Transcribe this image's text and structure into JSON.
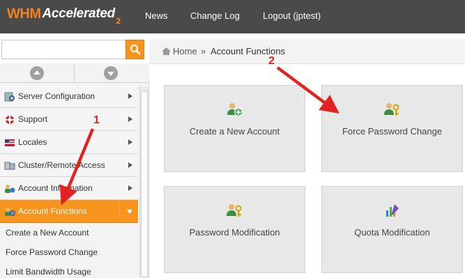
{
  "topbar": {
    "logo_brand": "WHM",
    "logo_name": "Accelerated",
    "logo_version": "2",
    "nav": [
      "News",
      "Change Log",
      "Logout (jptest)"
    ]
  },
  "search": {
    "placeholder": "",
    "value": ""
  },
  "breadcrumb": {
    "home": "Home",
    "separator": "»",
    "current": "Account Functions"
  },
  "sidebar": {
    "items": [
      {
        "label": "Server Configuration",
        "icon": "gear-icon"
      },
      {
        "label": "Support",
        "icon": "lifebuoy-icon"
      },
      {
        "label": "Locales",
        "icon": "flag-icon"
      },
      {
        "label": "Cluster/Remote Access",
        "icon": "servers-icon"
      },
      {
        "label": "Account Information",
        "icon": "user-info-icon"
      },
      {
        "label": "Account Functions",
        "icon": "user-gear-icon",
        "active": true
      }
    ],
    "subitems": [
      "Create a New Account",
      "Force Password Change",
      "Limit Bandwidth Usage"
    ]
  },
  "tiles": [
    {
      "label": "Create a New Account",
      "icon": "add-user-icon"
    },
    {
      "label": "Force Password Change",
      "icon": "user-key-icon"
    },
    {
      "label": "Password Modification",
      "icon": "user-key-icon"
    },
    {
      "label": "Quota Modification",
      "icon": "quota-chart-icon"
    }
  ],
  "annotations": [
    "1",
    "2"
  ],
  "colors": {
    "accent": "#f7941d",
    "topbar": "#4a4a4a",
    "annotation": "#e52222"
  }
}
